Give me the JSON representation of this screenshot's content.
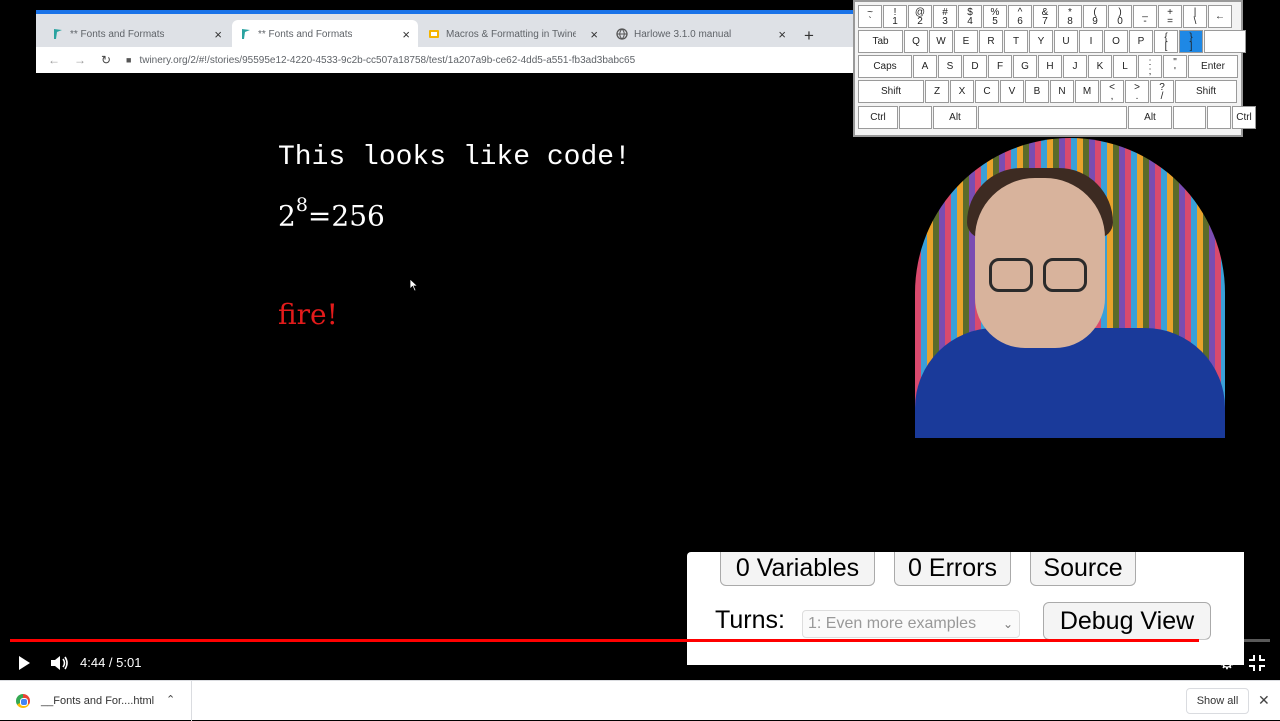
{
  "browser": {
    "tabs": [
      {
        "title": "** Fonts and Formats",
        "favicon": "twine-icon"
      },
      {
        "title": "** Fonts and Formats",
        "favicon": "twine-icon"
      },
      {
        "title": "Macros & Formatting in Twine 2 ...",
        "favicon": "slides-icon"
      },
      {
        "title": "Harlowe 3.1.0 manual",
        "favicon": "globe-icon"
      }
    ],
    "close_glyph": "×",
    "new_tab_glyph": "+",
    "url": "twinery.org/2/#!/stories/95595e12-4220-4533-9c2b-cc507a18758/test/1a207a9b-ce62-4dd5-a551-fb3ad3babc65"
  },
  "passage": {
    "code_text": "This looks like code!",
    "math_base": "2",
    "math_exp": "8",
    "math_rest": "=256",
    "fire_text": "fire!",
    "fire_color": "#e31b1b"
  },
  "keyboard": {
    "rows": [
      [
        "~\n`",
        "!\n1",
        "@\n2",
        "#\n3",
        "$\n4",
        "%\n5",
        "^\n6",
        "&\n7",
        "*\n8",
        "(\n9",
        ")\n0",
        "_\n-",
        "+\n=",
        "|\n\\",
        "←"
      ],
      [
        "Tab",
        "Q",
        "W",
        "E",
        "R",
        "T",
        "Y",
        "U",
        "I",
        "O",
        "P",
        "{\n[",
        "}\n]",
        ""
      ],
      [
        "Caps",
        "A",
        "S",
        "D",
        "F",
        "G",
        "H",
        "J",
        "K",
        "L",
        ":\n;",
        "\"\n'",
        "Enter"
      ],
      [
        "Shift",
        "Z",
        "X",
        "C",
        "V",
        "B",
        "N",
        "M",
        "<\n,",
        ">\n.",
        "?\n/",
        "Shift"
      ],
      [
        "Ctrl",
        "",
        "Alt",
        "",
        "Alt",
        "",
        "",
        "Ctrl"
      ]
    ],
    "highlight_color": "#1e88e5"
  },
  "debug": {
    "variables_label": "0 Variables",
    "errors_label": "0 Errors",
    "source_label": "Source",
    "turns_label": "Turns:",
    "turns_value": "1: Even more examples",
    "debug_view_label": "Debug View"
  },
  "player": {
    "time": "4:44 / 5:01",
    "progress_fraction": 0.944,
    "progress_color": "#ff0000"
  },
  "downloads": {
    "file_name": "__Fonts and For....html",
    "show_all_label": "Show all",
    "close_glyph": "✕"
  }
}
